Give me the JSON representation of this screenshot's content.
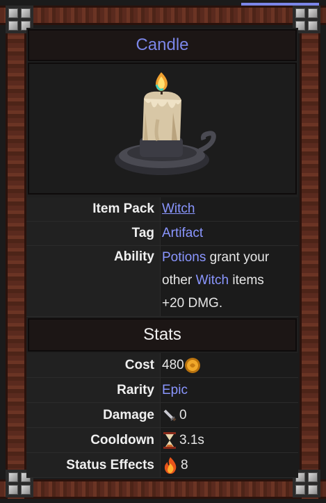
{
  "item": {
    "name": "Candle",
    "image_icon": "candle-icon"
  },
  "info": {
    "item_pack": {
      "label": "Item Pack",
      "value": "Witch"
    },
    "tag": {
      "label": "Tag",
      "value": "Artifact"
    },
    "ability": {
      "label": "Ability",
      "line1_link": "Potions",
      "line1_text": " grant your",
      "line2_text_a": "other ",
      "line2_link": "Witch",
      "line2_text_b": " items",
      "line3_text": "+20 DMG."
    }
  },
  "stats": {
    "header": "Stats",
    "cost": {
      "label": "Cost",
      "value": "480",
      "icon": "gold-coin-icon"
    },
    "rarity": {
      "label": "Rarity",
      "value": "Epic"
    },
    "damage": {
      "label": "Damage",
      "value": "0",
      "icon": "dagger-icon"
    },
    "cooldown": {
      "label": "Cooldown",
      "value": "3.1s",
      "icon": "hourglass-icon"
    },
    "status_effects": {
      "label": "Status Effects",
      "value": "8",
      "icon": "fire-icon"
    }
  },
  "colors": {
    "accent": "#7b86e8",
    "link": "#8a96ff",
    "frame_wood": "#5a2a1e"
  }
}
